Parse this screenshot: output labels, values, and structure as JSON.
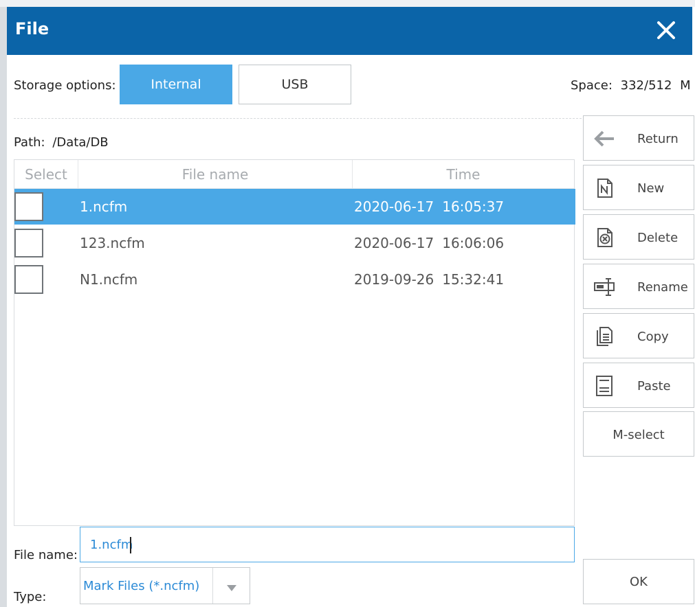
{
  "window": {
    "title": "File",
    "close_icon": "close-icon"
  },
  "storage": {
    "label": "Storage options:",
    "options": [
      "Internal",
      "USB"
    ],
    "selected": "Internal",
    "space_label": "Space:",
    "space_value": "332/512",
    "space_unit": "M"
  },
  "path": {
    "label": "Path:",
    "value": "/Data/DB"
  },
  "table": {
    "columns": [
      "Select",
      "File name",
      "Time"
    ],
    "rows": [
      {
        "name": "1.ncfm",
        "date": "2020-06-17",
        "time": "16:05:37",
        "selected": true
      },
      {
        "name": "123.ncfm",
        "date": "2020-06-17",
        "time": "16:06:06",
        "selected": false
      },
      {
        "name": "N1.ncfm",
        "date": "2019-09-26",
        "time": "15:32:41",
        "selected": false
      }
    ]
  },
  "actions": [
    {
      "label": "Return",
      "icon": "arrow-left-icon"
    },
    {
      "label": "New",
      "icon": "new-file-icon"
    },
    {
      "label": "Delete",
      "icon": "delete-file-icon"
    },
    {
      "label": "Rename",
      "icon": "rename-icon"
    },
    {
      "label": "Copy",
      "icon": "copy-icon"
    },
    {
      "label": "Paste",
      "icon": "paste-icon"
    },
    {
      "label": "M-select",
      "icon": ""
    }
  ],
  "filename": {
    "label": "File name:",
    "value": "1.ncfm"
  },
  "type": {
    "label": "Type:",
    "value": "Mark Files (*.ncfm)",
    "icon": "dropdown-arrow-icon"
  },
  "ok_label": "OK",
  "colors": {
    "titlebar": "#0b64a8",
    "accent": "#4aa8e6",
    "border": "#c5c9cc"
  }
}
